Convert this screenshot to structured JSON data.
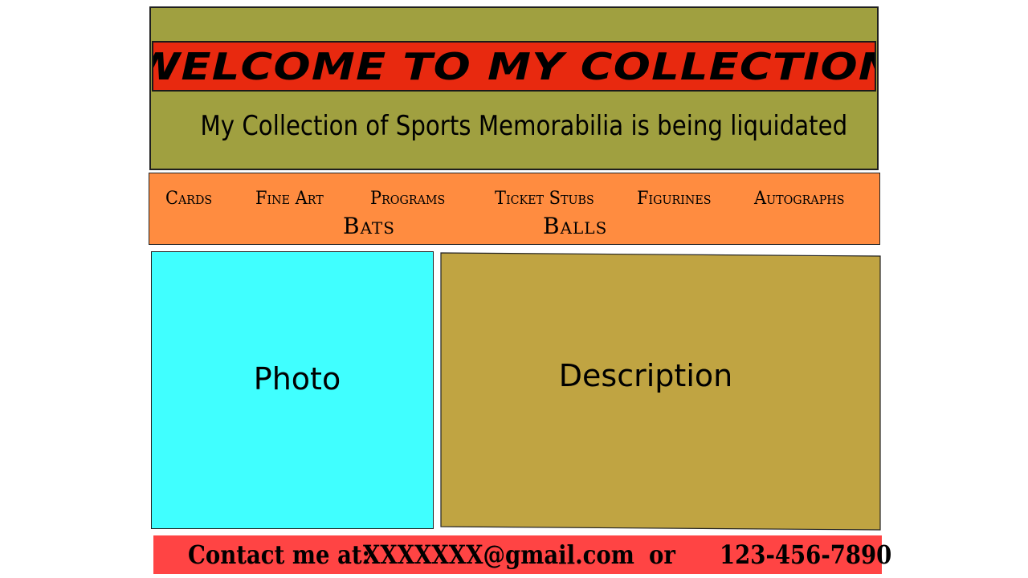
{
  "header": {
    "title": "WELCOME TO MY COLLECTION",
    "subtitle": "My Collection of Sports Memorabilia is being liquidated"
  },
  "nav": {
    "cards": "Cards",
    "fine_art": "Fine Art",
    "programs": "Programs",
    "ticket_stubs": "Ticket Stubs",
    "figurines": "Figurines",
    "autographs": "Autographs",
    "bats": "Bats",
    "balls": "Balls"
  },
  "main": {
    "photo_label": "Photo",
    "description_label": "Description"
  },
  "contact": {
    "label": "Contact me at:",
    "email": "XXXXXXX@gmail.com",
    "separator": "or",
    "phone": "123-456-7890"
  },
  "colors": {
    "header_bg": "#a0a040",
    "title_bar_bg": "#e8290f",
    "nav_bg": "#ff8c40",
    "photo_bg": "#40ffff",
    "description_bg": "#c0a442",
    "contact_bg": "#ff4444"
  }
}
